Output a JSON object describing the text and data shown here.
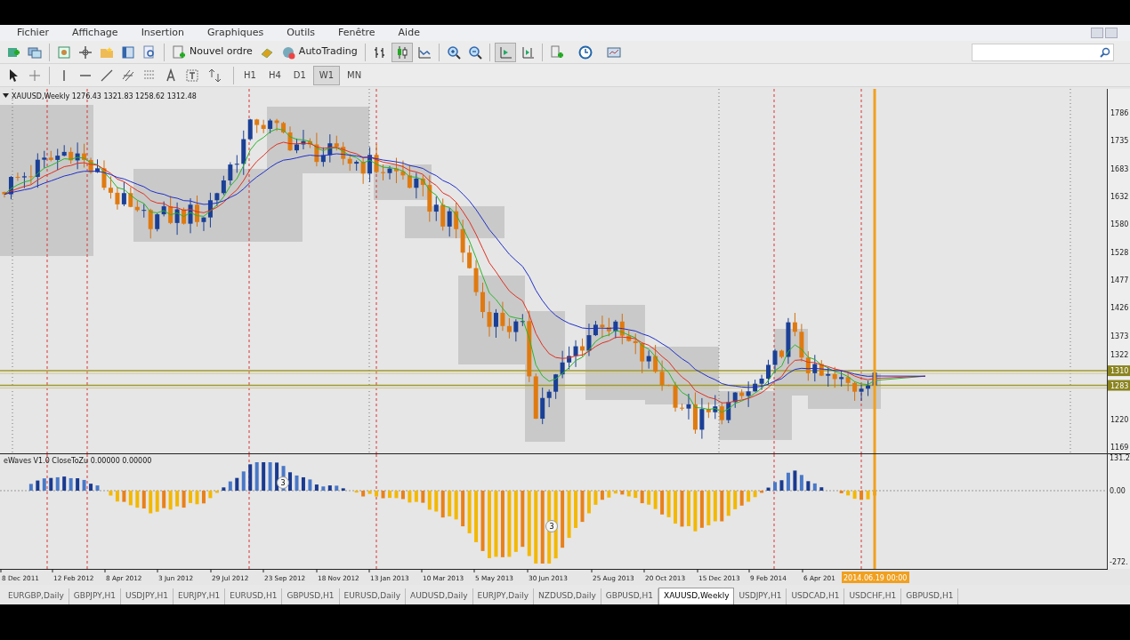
{
  "menu": [
    "Fichier",
    "Affichage",
    "Insertion",
    "Graphiques",
    "Outils",
    "Fenêtre",
    "Aide"
  ],
  "toolbar": {
    "new_order": "Nouvel ordre",
    "autotrading": "AutoTrading"
  },
  "timeframes": [
    {
      "label": "H1",
      "selected": false
    },
    {
      "label": "H4",
      "selected": false
    },
    {
      "label": "D1",
      "selected": false
    },
    {
      "label": "W1",
      "selected": true
    },
    {
      "label": "MN",
      "selected": false
    }
  ],
  "chart": {
    "title": "XAUUSD,Weekly",
    "ohlc": "1276.43 1321.83 1258.62 1312.48",
    "price_labels": [
      "1786",
      "1735",
      "1683",
      "1632",
      "1580",
      "1528",
      "1477",
      "1426",
      "1373",
      "1322",
      "1220",
      "1169"
    ],
    "price_markers": [
      "1310",
      "1283"
    ],
    "dates": [
      "8 Dec 2011",
      "12 Feb 2012",
      "8 Apr 2012",
      "3 Jun 2012",
      "29 Jul 2012",
      "23 Sep 2012",
      "18 Nov 2012",
      "13 Jan 2013",
      "10 Mar 2013",
      "5 May 2013",
      "30 Jun 2013",
      "25 Aug 2013",
      "20 Oct 2013",
      "15 Dec 2013",
      "9 Feb 2014",
      "6 Apr 201"
    ],
    "cursor_date": "2014.06.19 00:00"
  },
  "indicator": {
    "title": "eWaves V1.0 CloseToZu 0.00000 0.00000",
    "scale_labels": [
      "131.2",
      "0.00",
      "-272."
    ],
    "wave_labels": [
      "3",
      "3"
    ]
  },
  "tabs": [
    {
      "label": "EURGBP,Daily",
      "selected": false
    },
    {
      "label": "GBPJPY,H1",
      "selected": false
    },
    {
      "label": "USDJPY,H1",
      "selected": false
    },
    {
      "label": "EURJPY,H1",
      "selected": false
    },
    {
      "label": "EURUSD,H1",
      "selected": false
    },
    {
      "label": "GBPUSD,H1",
      "selected": false
    },
    {
      "label": "EURUSD,Daily",
      "selected": false
    },
    {
      "label": "AUDUSD,Daily",
      "selected": false
    },
    {
      "label": "EURJPY,Daily",
      "selected": false
    },
    {
      "label": "NZDUSD,Daily",
      "selected": false
    },
    {
      "label": "GBPUSD,H1",
      "selected": false
    },
    {
      "label": "XAUUSD,Weekly",
      "selected": true
    },
    {
      "label": "USDJPY,H1",
      "selected": false
    },
    {
      "label": "USDCAD,H1",
      "selected": false
    },
    {
      "label": "USDCHF,H1",
      "selected": false
    },
    {
      "label": "GBPUSD,H1",
      "selected": false
    }
  ]
}
